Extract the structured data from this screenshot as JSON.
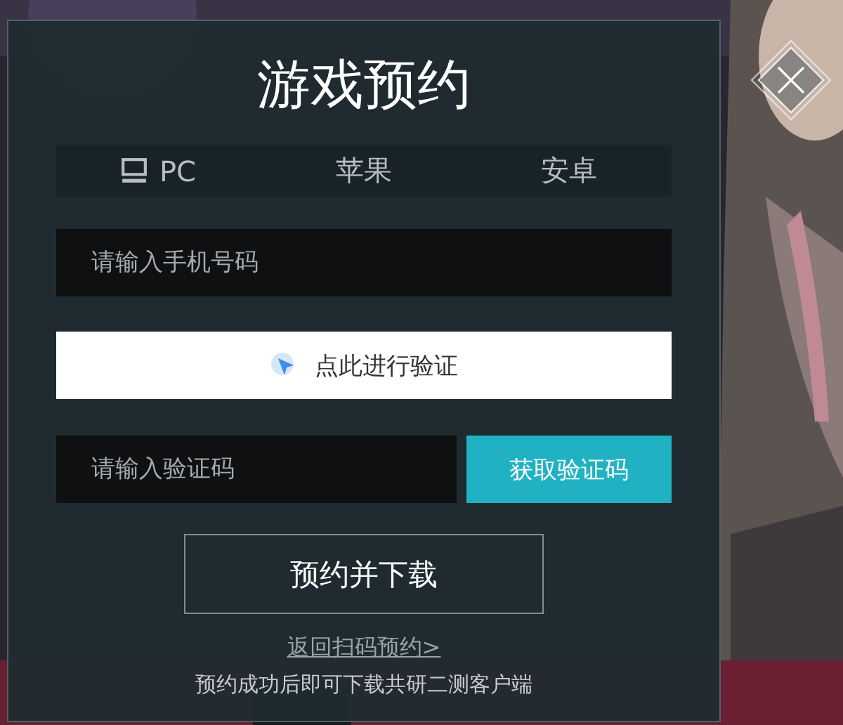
{
  "dialog": {
    "title": "游戏预约",
    "tabs": [
      {
        "label": "PC",
        "kind": "icon"
      },
      {
        "label": "苹果",
        "kind": "text"
      },
      {
        "label": "安卓",
        "kind": "text"
      }
    ],
    "phone_field": {
      "placeholder": "请输入手机号码"
    },
    "verify_button": {
      "label": "点此进行验证"
    },
    "code_field": {
      "placeholder": "请输入验证码"
    },
    "get_code_button": {
      "label": "获取验证码"
    },
    "submit_button": {
      "label": "预约并下载"
    },
    "back_link": "返回扫码预约>",
    "note": "预约成功后即可下载共研二测客户端"
  }
}
